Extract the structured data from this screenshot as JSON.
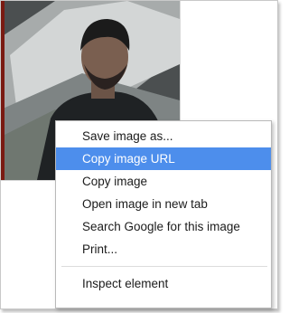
{
  "context_menu": {
    "items": [
      {
        "label": "Save image as...",
        "highlighted": false
      },
      {
        "label": "Copy image URL",
        "highlighted": true
      },
      {
        "label": "Copy image",
        "highlighted": false
      },
      {
        "label": "Open image in new tab",
        "highlighted": false
      },
      {
        "label": "Search Google for this image",
        "highlighted": false
      },
      {
        "label": "Print...",
        "highlighted": false
      }
    ],
    "footer_items": [
      {
        "label": "Inspect element",
        "highlighted": false
      }
    ],
    "highlight_color": "#4d8eec"
  }
}
